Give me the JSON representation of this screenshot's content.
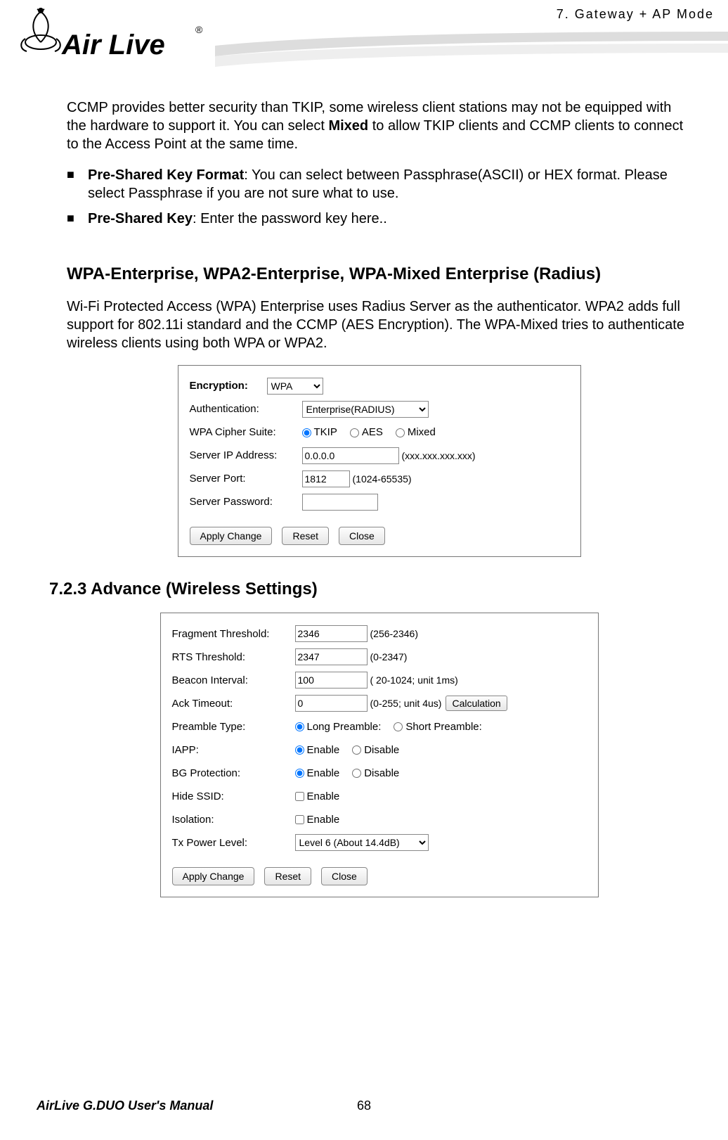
{
  "chapter": "7.  Gateway  +  AP    Mode",
  "logo_text": "Air Live",
  "intro_para": "CCMP provides better security than TKIP, some wireless client stations may not be equipped with the hardware to support it. You can select ",
  "intro_bold": "Mixed",
  "intro_tail": " to allow TKIP clients and CCMP clients to connect to the Access Point at the same time.",
  "bullets": [
    {
      "label": "Pre-Shared Key Format",
      "text": ":    You can select between Passphrase(ASCII) or HEX format.    Please select Passphrase if you are not sure what to use."
    },
    {
      "label": "Pre-Shared Key",
      "text": ":    Enter the password key here.."
    }
  ],
  "section_heading": "WPA-Enterprise, WPA2-Enterprise, WPA-Mixed Enterprise (Radius)",
  "section_para": "Wi-Fi Protected Access (WPA) Enterprise uses Radius Server as the authenticator. WPA2 adds full support for 802.11i standard and the CCMP (AES Encryption).    The WPA-Mixed tries to authenticate wireless clients using both WPA or WPA2.",
  "wpa_panel": {
    "encryption_label": "Encryption:",
    "encryption_value": "WPA",
    "auth_label": "Authentication:",
    "auth_value": "Enterprise(RADIUS)",
    "cipher_label": "WPA Cipher Suite:",
    "cipher_options": [
      "TKIP",
      "AES",
      "Mixed"
    ],
    "server_ip_label": "Server IP Address:",
    "server_ip_value": "0.0.0.0",
    "server_ip_hint": "(xxx.xxx.xxx.xxx)",
    "server_port_label": "Server Port:",
    "server_port_value": "1812",
    "server_port_hint": "(1024-65535)",
    "server_pw_label": "Server Password:",
    "server_pw_value": "",
    "btn_apply": "Apply Change",
    "btn_reset": "Reset",
    "btn_close": "Close"
  },
  "subsection_heading": "7.2.3 Advance (Wireless Settings)",
  "adv_panel": {
    "frag_label": "Fragment Threshold:",
    "frag_value": "2346",
    "frag_hint": "(256-2346)",
    "rts_label": "RTS Threshold:",
    "rts_value": "2347",
    "rts_hint": "(0-2347)",
    "beacon_label": "Beacon Interval:",
    "beacon_value": "100",
    "beacon_hint": "( 20-1024; unit 1ms)",
    "ack_label": "Ack Timeout:",
    "ack_value": "0",
    "ack_hint": "(0-255; unit 4us)",
    "ack_btn": "Calculation",
    "preamble_label": "Preamble Type:",
    "preamble_options": [
      "Long Preamble:",
      "Short Preamble:"
    ],
    "iapp_label": "IAPP:",
    "bg_label": "BG Protection:",
    "enable_disable": [
      "Enable",
      "Disable"
    ],
    "hide_label": "Hide SSID:",
    "iso_label": "Isolation:",
    "enable_only": "Enable",
    "tx_label": "Tx Power Level:",
    "tx_value": "Level 6 (About 14.4dB)",
    "btn_apply": "Apply Change",
    "btn_reset": "Reset",
    "btn_close": "Close"
  },
  "footer_left": "AirLive G.DUO User's Manual",
  "footer_page": "68"
}
